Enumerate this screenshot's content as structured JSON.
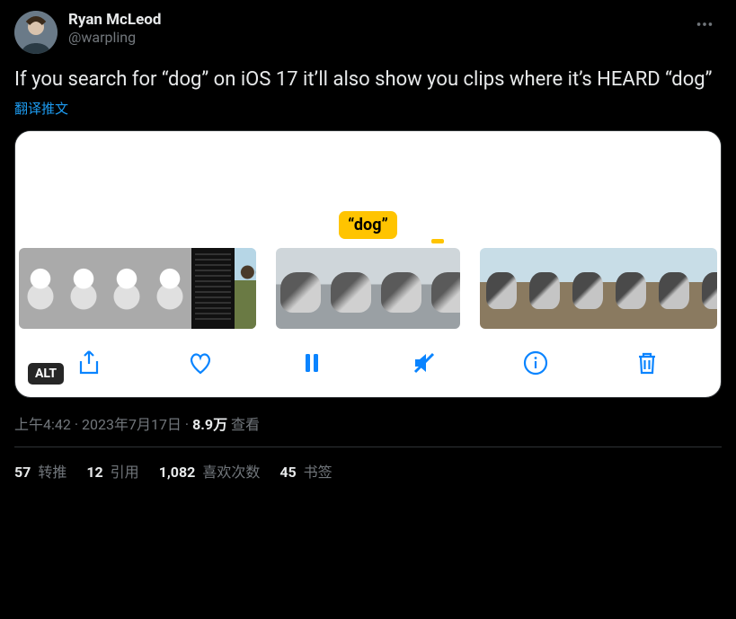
{
  "tweet": {
    "author": {
      "display_name": "Ryan McLeod",
      "handle": "@warpling"
    },
    "text": "If you search for “dog” on iOS 17 it’ll also show you clips where it’s HEARD “dog”",
    "translate_label": "翻译推文",
    "media": {
      "search_token": "“dog”",
      "alt_badge": "ALT"
    },
    "meta": {
      "time": "上午4:42",
      "date": "2023年7月17日",
      "separator": " · ",
      "views_count": "8.9万",
      "views_label": " 查看"
    },
    "stats": {
      "retweets": {
        "count": "57",
        "label": " 转推"
      },
      "quotes": {
        "count": "12",
        "label": " 引用"
      },
      "likes": {
        "count": "1,082",
        "label": " 喜欢次数"
      },
      "bookmarks": {
        "count": "45",
        "label": " 书签"
      }
    }
  }
}
